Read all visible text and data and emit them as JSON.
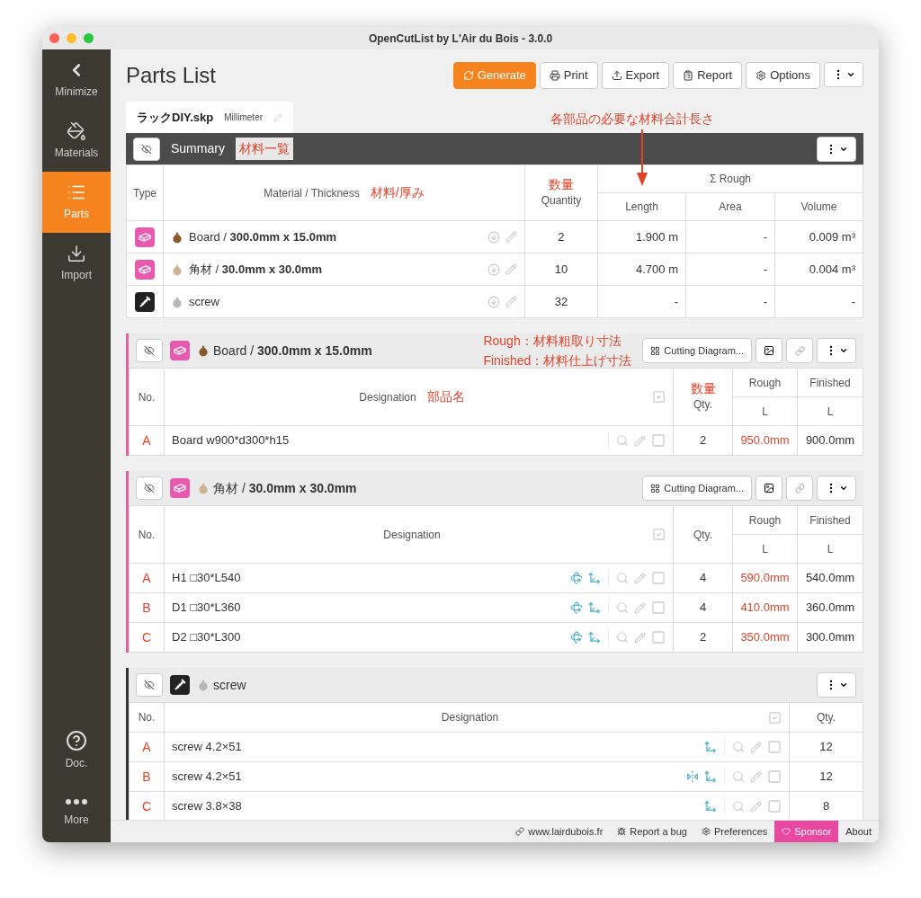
{
  "window": {
    "title": "OpenCutList by L'Air du Bois - 3.0.0"
  },
  "sidebar": {
    "items": [
      {
        "kind": "minimize",
        "label": "Minimize",
        "selected": false
      },
      {
        "kind": "materials",
        "label": "Materials",
        "selected": false
      },
      {
        "kind": "parts",
        "label": "Parts",
        "selected": true
      },
      {
        "kind": "import",
        "label": "Import",
        "selected": false
      }
    ],
    "bottom_items": [
      {
        "kind": "doc",
        "label": "Doc."
      },
      {
        "kind": "more",
        "label": "More"
      }
    ]
  },
  "header": {
    "title": "Parts List",
    "buttons": [
      {
        "kind": "generate",
        "label": "Generate"
      },
      {
        "kind": "print",
        "label": "Print"
      },
      {
        "kind": "export",
        "label": "Export"
      },
      {
        "kind": "report",
        "label": "Report"
      },
      {
        "kind": "options",
        "label": "Options"
      },
      {
        "kind": "menu"
      }
    ]
  },
  "file_tab": {
    "filename": "ラックDIY.skp",
    "unit": "Millimeter"
  },
  "summary": {
    "title": "Summary",
    "note": "材料一覧",
    "callout": "各部品の必要な材料合計長さ",
    "columns": {
      "type": "Type",
      "material": "Material / Thickness",
      "material_note": "材料/厚み",
      "quantity": "Quantity",
      "quantity_note": "数量",
      "rough": "Σ Rough",
      "length": "Length",
      "area": "Area",
      "volume": "Volume"
    },
    "rows": [
      {
        "kind": "sheet",
        "color": "#8b5a2b",
        "material": "Board / **300.0mm x 15.0mm**",
        "quantity": "2",
        "length": "1.900 m",
        "area": "-",
        "volume": "0.009 m³"
      },
      {
        "kind": "sheet",
        "color": "#cdb497",
        "material": "角材 / **30.0mm x 30.0mm**",
        "quantity": "10",
        "length": "4.700 m",
        "area": "-",
        "volume": "0.004 m³"
      },
      {
        "kind": "hardware",
        "color": "#b8b8b8",
        "material": "screw",
        "quantity": "32",
        "length": "-",
        "area": "-",
        "volume": "-"
      }
    ]
  },
  "groups": [
    {
      "kind": "sheet",
      "color": "#8b5a2b",
      "title": "Board / **300.0mm x 15.0mm**",
      "notes": [
        "Rough：材料粗取り寸法",
        "Finished：材料仕上げ寸法"
      ],
      "buttons": [
        {
          "kind": "cutting",
          "label": "Cutting Diagram..."
        },
        {
          "kind": "labels"
        },
        {
          "kind": "link"
        },
        {
          "kind": "menu"
        }
      ],
      "columns": {
        "no": "No.",
        "designation": "Designation",
        "designation_note": "部品名",
        "qty": "Qty.",
        "qty_note": "数量",
        "rough": "Rough",
        "finished": "Finished",
        "rough_dim": "L",
        "finished_dim": "L"
      },
      "all_checked": true,
      "rows": [
        {
          "no": "A",
          "name": "Board w900*d300*h15",
          "flags": [],
          "qty": "2",
          "rough": "950.0mm",
          "finished": "900.0mm",
          "checked": false
        }
      ]
    },
    {
      "kind": "sheet",
      "color": "#cdb497",
      "title": "角材 / **30.0mm x 30.0mm**",
      "buttons": [
        {
          "kind": "cutting",
          "label": "Cutting Diagram..."
        },
        {
          "kind": "labels"
        },
        {
          "kind": "link"
        },
        {
          "kind": "menu"
        }
      ],
      "columns": {
        "no": "No.",
        "designation": "Designation",
        "qty": "Qty.",
        "rough": "Rough",
        "finished": "Finished",
        "rough_dim": "L",
        "finished_dim": "L"
      },
      "all_checked": true,
      "rows": [
        {
          "no": "A",
          "name": "H1 □30*L540",
          "flags": [
            {
              "kind": "rotation"
            },
            {
              "kind": "axes"
            }
          ],
          "qty": "4",
          "rough": "590.0mm",
          "finished": "540.0mm",
          "checked": false
        },
        {
          "no": "B",
          "name": "D1 □30*L360",
          "flags": [
            {
              "kind": "rotation"
            },
            {
              "kind": "axes"
            }
          ],
          "qty": "4",
          "rough": "410.0mm",
          "finished": "360.0mm",
          "checked": false
        },
        {
          "no": "C",
          "name": "D2 □30*L300",
          "flags": [
            {
              "kind": "rotation"
            },
            {
              "kind": "axes"
            }
          ],
          "qty": "2",
          "rough": "350.0mm",
          "finished": "300.0mm",
          "checked": false
        }
      ]
    },
    {
      "kind": "hardware",
      "color": "#b8b8b8",
      "title": "screw",
      "buttons": [
        {
          "kind": "menu"
        }
      ],
      "columns": {
        "no": "No.",
        "designation": "Designation",
        "qty": "Qty."
      },
      "all_checked": true,
      "rows": [
        {
          "no": "A",
          "name": "screw 4.2×51",
          "flags": [
            {
              "kind": "axes"
            }
          ],
          "qty": "12",
          "checked": false
        },
        {
          "no": "B",
          "name": "screw 4.2×51",
          "flags": [
            {
              "kind": "mirror"
            },
            {
              "kind": "axes"
            }
          ],
          "qty": "12",
          "checked": false
        },
        {
          "no": "C",
          "name": "screw 3.8×38",
          "flags": [
            {
              "kind": "axes"
            }
          ],
          "qty": "8",
          "checked": false
        }
      ]
    }
  ],
  "footer": {
    "links": [
      {
        "kind": "website",
        "label": "www.lairdubois.fr"
      },
      {
        "kind": "bug",
        "label": "Report a bug"
      },
      {
        "kind": "preferences",
        "label": "Preferences"
      },
      {
        "kind": "sponsor",
        "label": "Sponsor"
      },
      {
        "kind": "about",
        "label": "About"
      }
    ]
  }
}
